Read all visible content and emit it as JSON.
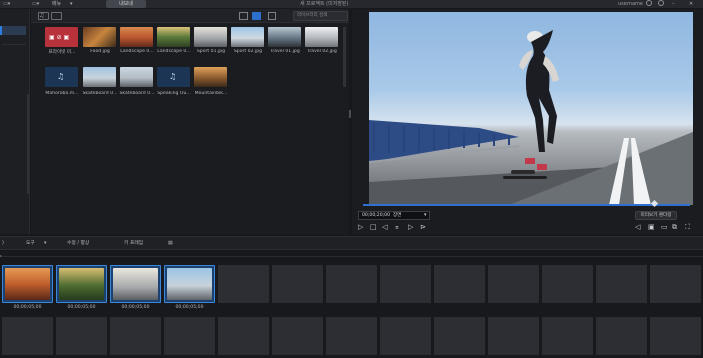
{
  "topbar": {
    "menu": "메뉴",
    "button": "내보내",
    "title": "새 프로젝트 (미저장된)",
    "user": "username"
  },
  "library": {
    "search_placeholder": "라이브러리 검색",
    "items": [
      {
        "caption": "프라이빗 미..."
      },
      {
        "caption": "Food.jpg"
      },
      {
        "caption": "Landscape 0..."
      },
      {
        "caption": "Landscape 0..."
      },
      {
        "caption": "Sport 01.jpg"
      },
      {
        "caption": "Sport 02.jpg"
      },
      {
        "caption": "Travel 01.jpg"
      },
      {
        "caption": "Travel 02.jpg"
      },
      {
        "caption": "Mahoroba.m..."
      },
      {
        "caption": "Skateboard 0..."
      },
      {
        "caption": "Skateboard 0..."
      },
      {
        "caption": "Speaking Ou..."
      },
      {
        "caption": "Mountainbik..."
      }
    ]
  },
  "preview": {
    "timecode": "00;00;20;00  장면",
    "mode_button": "미리보기 렌더링",
    "progress": 0.89
  },
  "toolbar": {
    "tools": "도구",
    "fix_enhance": "수정 / 향상",
    "keyframe": "키 프레임"
  },
  "timeline": {
    "clips": [
      {
        "duration": "00;00;05;00"
      },
      {
        "duration": "00;00;05;00"
      },
      {
        "duration": "00;00;05;00"
      },
      {
        "duration": "00;00;05;00"
      }
    ]
  },
  "colors": {
    "accent": "#2b7de0",
    "background": "#16181c"
  }
}
